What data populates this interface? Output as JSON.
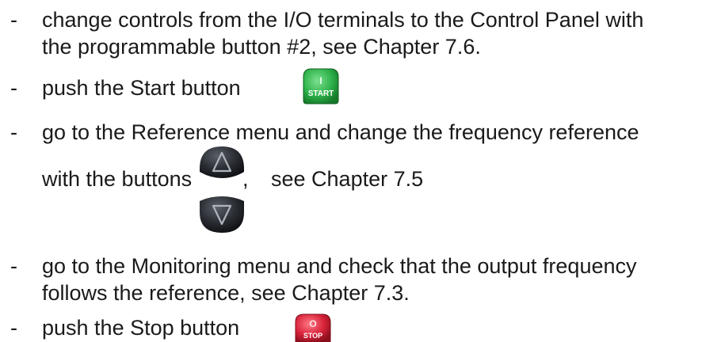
{
  "instructions": {
    "dash": "-",
    "item1_line1": "change controls from the I/O terminals to the Control Panel with",
    "item1_line2": "the programmable button #2, see Chapter 7.6.",
    "item2_text": "push the Start button",
    "item3_line1": "go to the Reference menu and change the frequency reference",
    "item3_line2_a": "with the buttons",
    "item3_comma": ",",
    "item3_line2_b": "see Chapter 7.5",
    "item4_line1": "go to the Monitoring menu and check that the output frequency",
    "item4_line2": "follows the reference, see Chapter 7.3.",
    "item5_text": "push the Stop button"
  },
  "buttons": {
    "start": {
      "label": "START",
      "symbol": "I",
      "color": "#2eb24a"
    },
    "up": {
      "icon": "up-triangle-icon",
      "color": "#2a2d33"
    },
    "down": {
      "icon": "down-triangle-icon",
      "color": "#2a2d33"
    },
    "stop": {
      "label": "STOP",
      "symbol": "O",
      "color": "#d9233a"
    }
  }
}
